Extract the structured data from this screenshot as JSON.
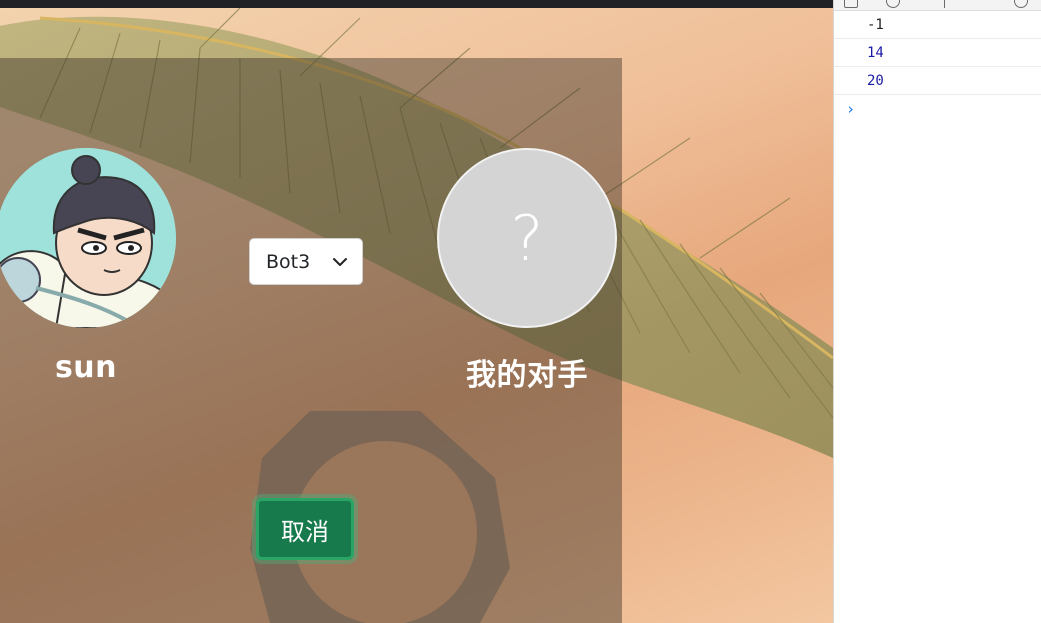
{
  "player": {
    "name": "sun",
    "avatar_icon": "cartoon-boy-avatar-icon"
  },
  "opponent": {
    "name": "我的对手",
    "avatar_placeholder": "?"
  },
  "bot_select": {
    "selected": "Bot3",
    "icon": "chevron-down-icon"
  },
  "cancel_button": {
    "label": "取消"
  },
  "console": {
    "lines": [
      "-1",
      "14",
      "20"
    ],
    "prompt": "›"
  },
  "colors": {
    "accent": "#177a4c",
    "overlay": "rgba(60,50,40,0.45)"
  }
}
